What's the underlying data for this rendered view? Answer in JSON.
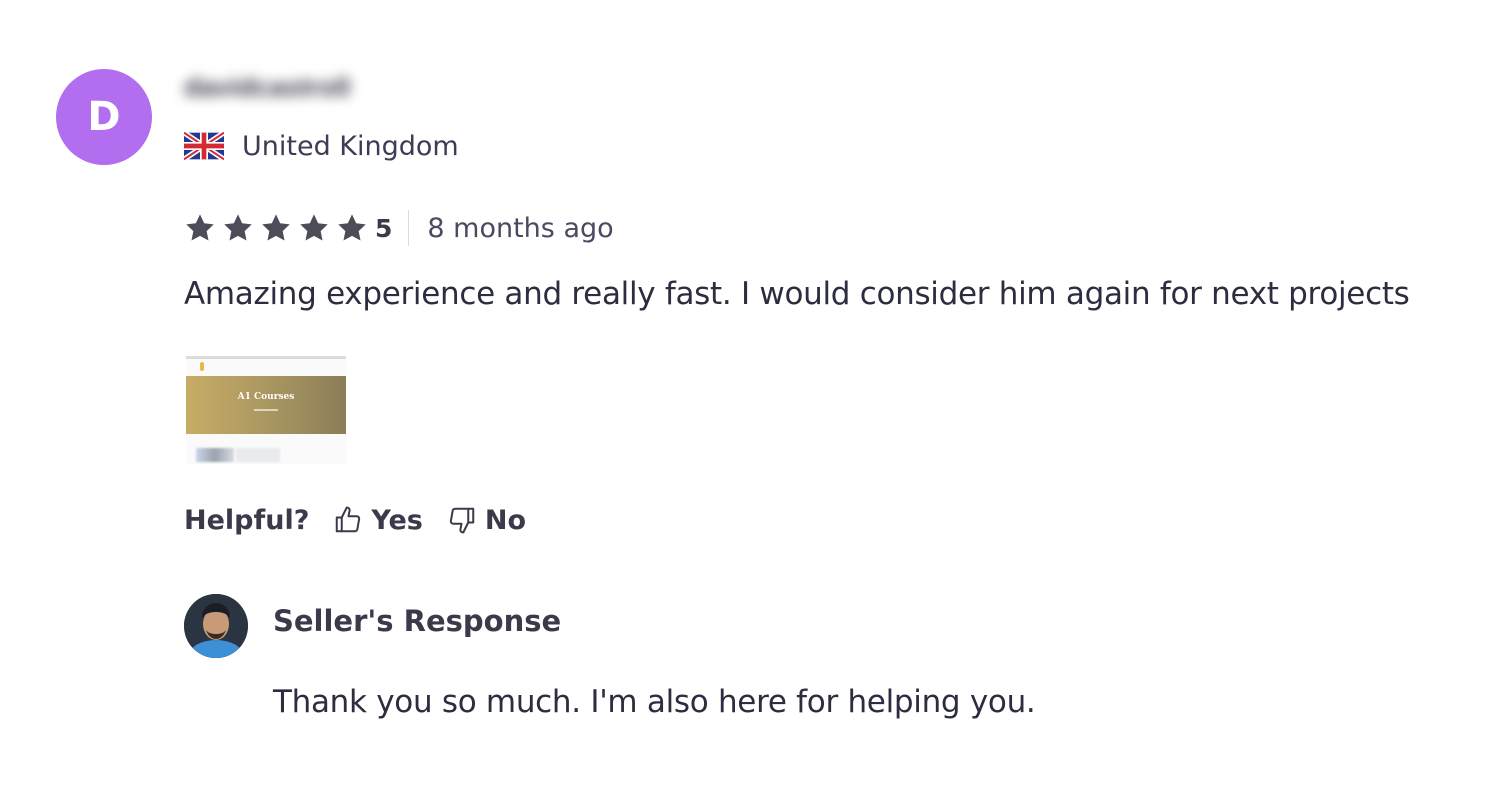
{
  "reviewer": {
    "avatar_initial": "D",
    "avatar_color": "#b36ef0",
    "username": "davidcastro0",
    "country": "United Kingdom",
    "flag_icon": "uk-flag-icon"
  },
  "rating": {
    "stars": 5,
    "value": "5",
    "star_color": "#4d4d5a",
    "time_ago": "8 months ago"
  },
  "review": {
    "text": "Amazing experience and really fast. I would consider him again for next projects"
  },
  "attachment": {
    "banner_text": "A1 Courses"
  },
  "helpful": {
    "label": "Helpful?",
    "yes_label": "Yes",
    "no_label": "No",
    "yes_icon": "thumbs-up-icon",
    "no_icon": "thumbs-down-icon"
  },
  "seller_response": {
    "heading": "Seller's Response",
    "text": "Thank you so much. I'm also here for helping you."
  }
}
